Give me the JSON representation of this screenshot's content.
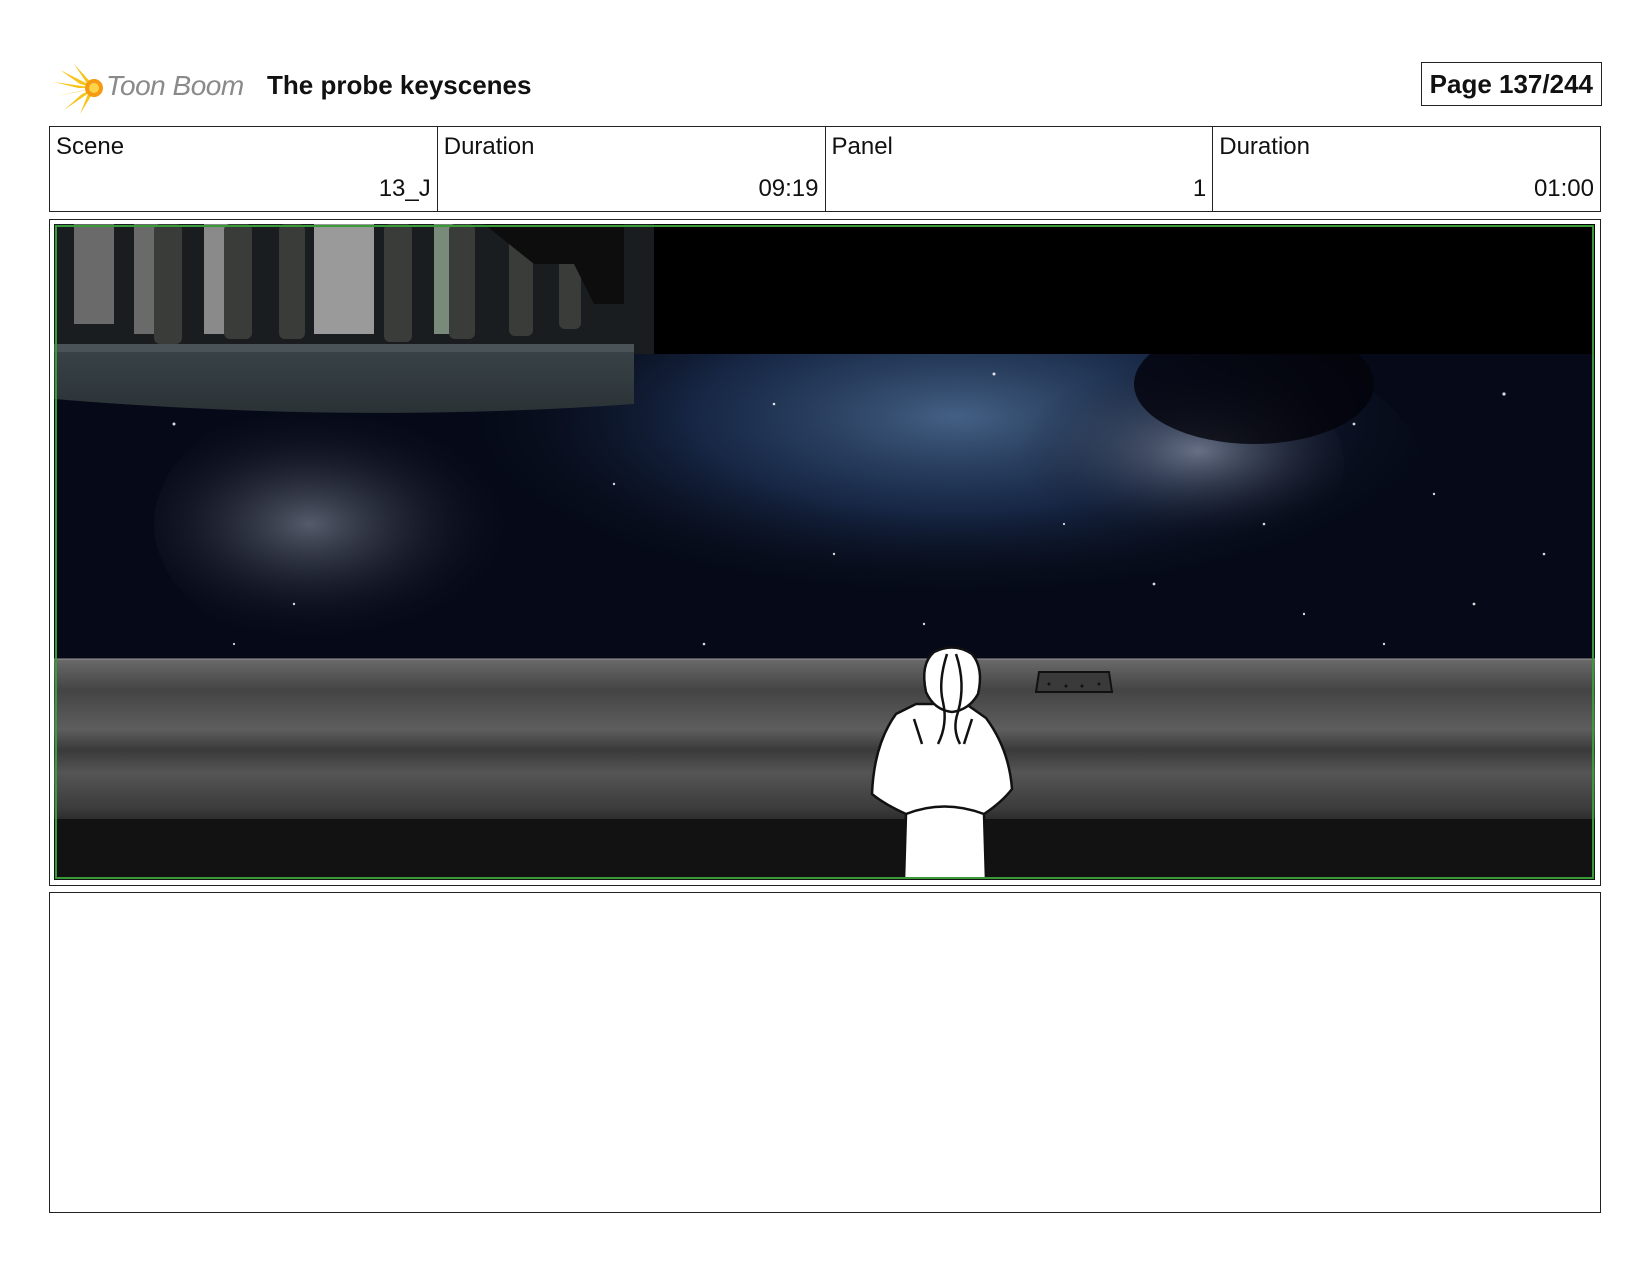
{
  "header": {
    "logo_text": "Toon Boom",
    "title": "The probe keyscenes",
    "page": "Page 137/244"
  },
  "info": {
    "scene_label": "Scene",
    "scene_value": "13_J",
    "scene_duration_label": "Duration",
    "scene_duration_value": "09:19",
    "panel_label": "Panel",
    "panel_value": "1",
    "panel_duration_label": "Duration",
    "panel_duration_value": "01:00"
  },
  "notes": {
    "text": ""
  },
  "colors": {
    "logo_yellow": "#f7c519",
    "logo_orange": "#f59a12",
    "frame_border": "#222222",
    "camera_frame": "#3a9a3a"
  }
}
